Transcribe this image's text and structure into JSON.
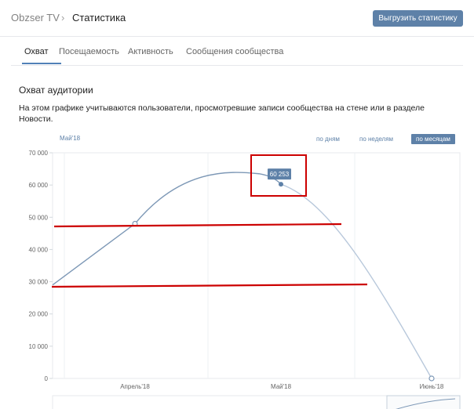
{
  "breadcrumb": {
    "group": "Obzser TV",
    "current": "Статистика"
  },
  "header": {
    "export_label": "Выгрузить статистику"
  },
  "tabs": [
    {
      "label": "Охват"
    },
    {
      "label": "Посещаемость"
    },
    {
      "label": "Активность"
    },
    {
      "label": "Сообщения сообщества"
    }
  ],
  "section": {
    "title": "Охват аудитории",
    "description": "На этом графике учитываются пользователи, просмотревшие записи сообщества на стене или в разделе Новости."
  },
  "period": {
    "label": "Май'18",
    "options": [
      "по дням",
      "по неделям",
      "по месяцам"
    ],
    "selected": "по месяцам"
  },
  "tooltip": {
    "value": "60 253"
  },
  "colors": {
    "accent": "#5e81a8",
    "annotation": "#cc0000",
    "line": "#7d98b6"
  },
  "chart_data": {
    "type": "line",
    "x": [
      "Апрель'18",
      "Май'18",
      "Июнь'18"
    ],
    "series": [
      {
        "values": [
          48000,
          60253,
          0
        ]
      }
    ],
    "yticks": [
      "70 000",
      "60 000",
      "50 000",
      "40 000",
      "30 000",
      "20 000",
      "10 000",
      "0"
    ],
    "ylim": [
      0,
      70000
    ]
  }
}
